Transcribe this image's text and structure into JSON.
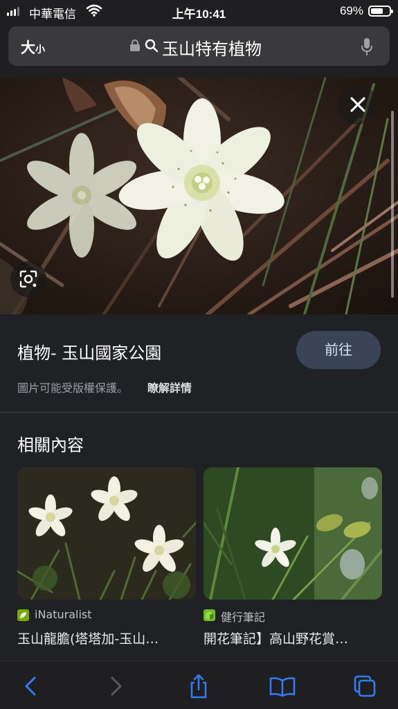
{
  "status_bar": {
    "carrier": "中華電信",
    "time": "上午10:41",
    "battery_percent": "69%",
    "battery_level": 0.69,
    "signal_icon": "cellular-signal-icon",
    "wifi_icon": "wifi-icon"
  },
  "address_bar": {
    "text_size_big": "大",
    "text_size_small": "小",
    "query": "玉山特有植物",
    "lock_icon": "lock-icon",
    "search_icon": "search-icon",
    "mic_icon": "microphone-icon"
  },
  "image_viewer": {
    "close_icon": "close-icon",
    "lens_icon": "google-lens-icon",
    "title": "植物- 玉山國家公園",
    "visit_label": "前往",
    "copyright_notice": "圖片可能受版權保護。",
    "learn_more_label": "瞭解詳情"
  },
  "related": {
    "heading": "相關內容",
    "items": [
      {
        "source": "iNaturalist",
        "title": "玉山龍膽(塔塔加-玉山…"
      },
      {
        "source": "健行筆記",
        "title": "開花筆記】高山野花賞…"
      }
    ]
  },
  "bottom_toolbar": {
    "icons": [
      "back-icon",
      "forward-icon",
      "share-icon",
      "bookmarks-icon",
      "tabs-icon"
    ]
  },
  "colors": {
    "background": "#202124",
    "bars": "#1f1f21",
    "ios_blue": "#2f7cf6",
    "visit_button": "#394457"
  }
}
